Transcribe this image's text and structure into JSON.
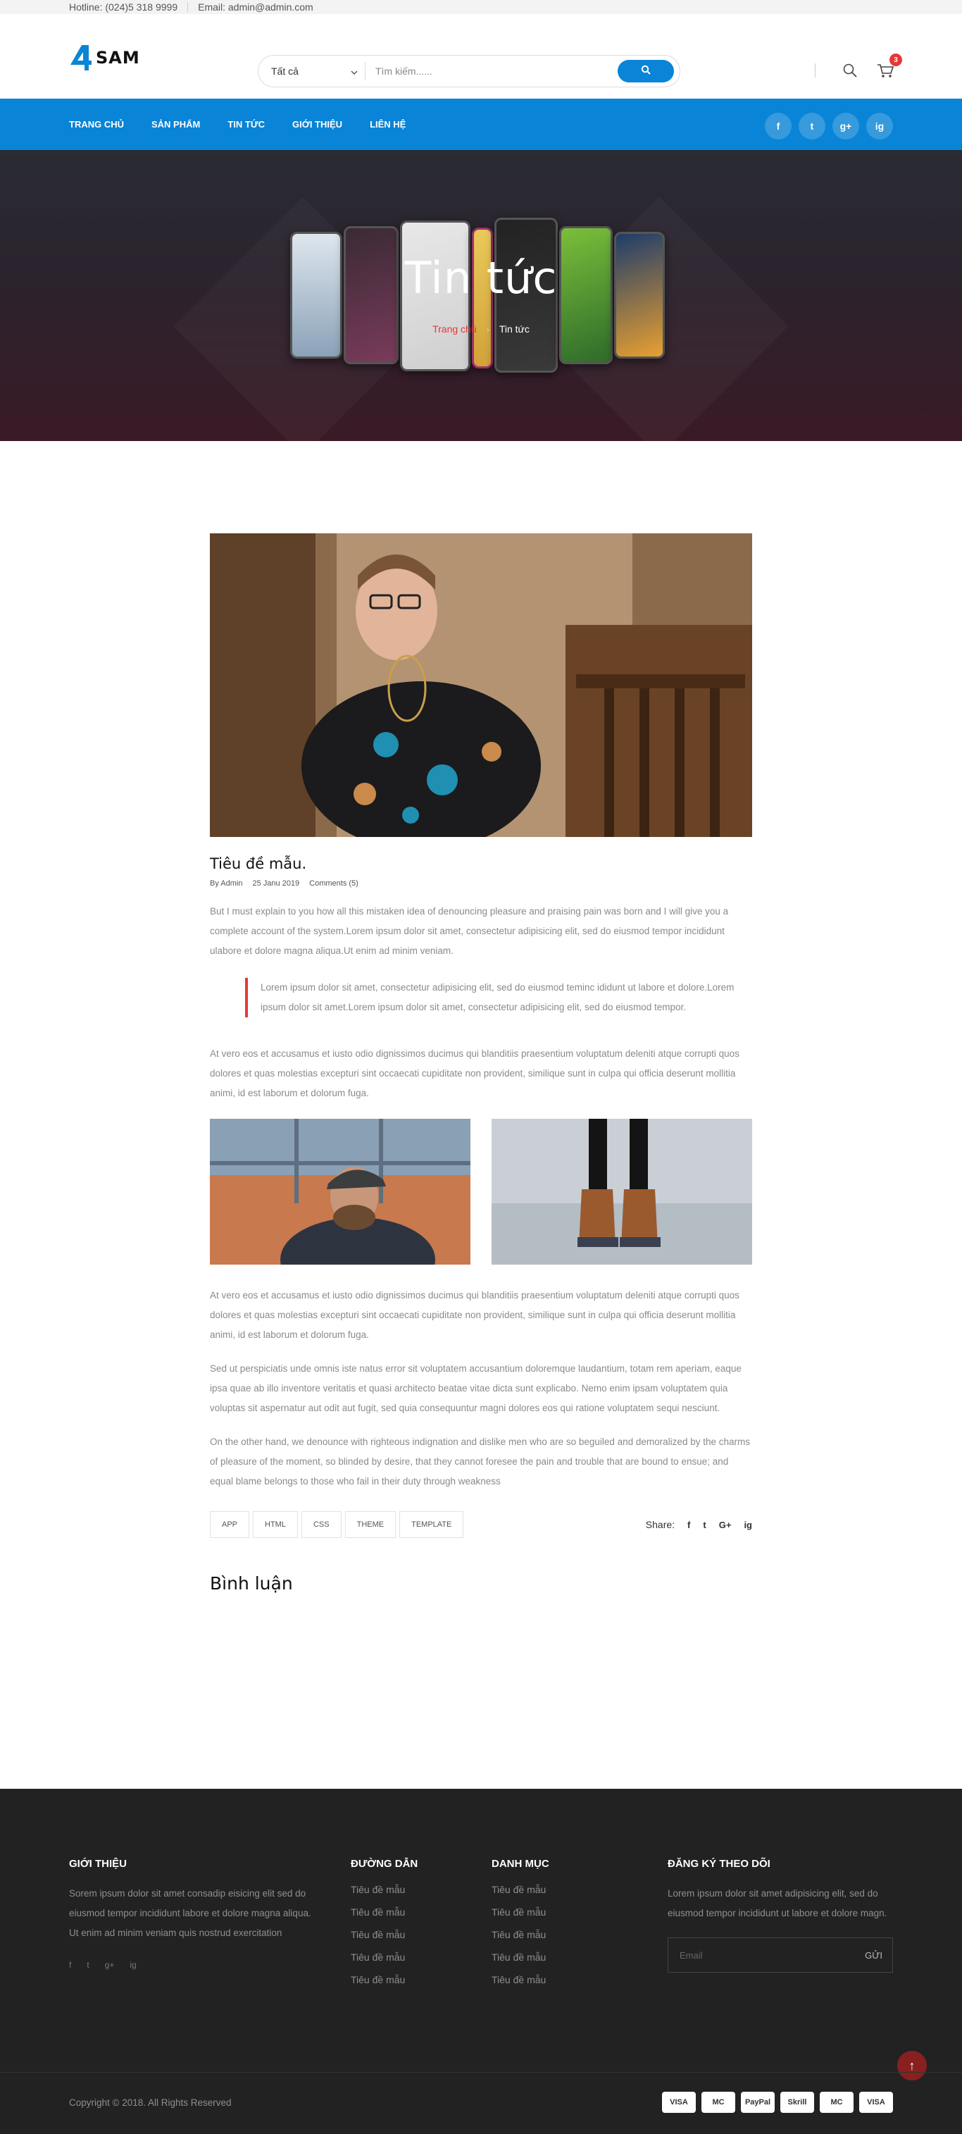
{
  "topbar": {
    "hotline": "Hotline: (024)5 318 9999",
    "email": "Email: admin@admin.com"
  },
  "header": {
    "logo_text": "SAM",
    "search": {
      "category": "Tất cả",
      "placeholder": "Tìm kiếm......"
    },
    "cart_count": "3"
  },
  "nav": {
    "items": [
      "TRANG CHỦ",
      "SẢN PHẨM",
      "TIN TỨC",
      "GIỚI THIỆU",
      "LIÊN HỆ"
    ],
    "social": [
      "f",
      "t",
      "g+",
      "ig"
    ]
  },
  "hero": {
    "title": "Tin tức",
    "breadcrumb_home": "Trang chủ",
    "breadcrumb_current": "Tin tức"
  },
  "post": {
    "title": "Tiêu đề mẫu.",
    "author": "By Admin",
    "date": "25 Janu 2019",
    "comments": "Comments (5)",
    "para1": "But I must explain to you how all this mistaken idea of denouncing pleasure and praising pain was born and I will give you a complete account of the system.Lorem ipsum dolor sit amet, consectetur adipisicing elit, sed do eiusmod tempor incididunt ulabore et dolore magna aliqua.Ut enim ad minim veniam.",
    "quote": "Lorem ipsum dolor sit amet, consectetur adipisicing elit, sed do eiusmod teminc ididunt ut labore et dolore.Lorem ipsum dolor sit amet.Lorem ipsum dolor sit amet, consectetur adipisicing elit, sed do eiusmod tempor.",
    "para2": "At vero eos et accusamus et iusto odio dignissimos ducimus qui blanditiis praesentium voluptatum deleniti atque corrupti quos dolores et quas molestias excepturi sint occaecati cupiditate non provident, similique sunt in culpa qui officia deserunt mollitia animi, id est laborum et dolorum fuga.",
    "para3": "At vero eos et accusamus et iusto odio dignissimos ducimus qui blanditiis praesentium voluptatum deleniti atque corrupti quos dolores et quas molestias excepturi sint occaecati cupiditate non provident, similique sunt in culpa qui officia deserunt mollitia animi, id est laborum et dolorum fuga.",
    "para4": "Sed ut perspiciatis unde omnis iste natus error sit voluptatem accusantium doloremque laudantium, totam rem aperiam, eaque ipsa quae ab illo inventore veritatis et quasi architecto beatae vitae dicta sunt explicabo. Nemo enim ipsam voluptatem quia voluptas sit aspernatur aut odit aut fugit, sed quia consequuntur magni dolores eos qui ratione voluptatem sequi nesciunt.",
    "para5": "On the other hand, we denounce with righteous indignation and dislike men who are so beguiled and demoralized by the charms of pleasure of the moment, so blinded by desire, that they cannot foresee the pain and trouble that are bound to ensue; and equal blame belongs to those who fail in their duty through weakness",
    "tags": [
      "APP",
      "HTML",
      "CSS",
      "THEME",
      "TEMPLATE"
    ],
    "share_label": "Share:",
    "share_icons": [
      "f",
      "t",
      "G+",
      "ig"
    ]
  },
  "comments_title": "Bình luận",
  "footer": {
    "about": {
      "title": "GIỚI THIỆU",
      "text": "Sorem ipsum dolor sit amet consadip eisicing elit sed do eiusmod tempor incididunt labore et dolore magna aliqua. Ut enim ad minim veniam quis nostrud exercitation",
      "social": [
        "f",
        "t",
        "g+",
        "ig"
      ]
    },
    "links": {
      "title": "ĐƯỜNG DẪN",
      "items": [
        "Tiêu đề mẫu",
        "Tiêu đề mẫu",
        "Tiêu đề mẫu",
        "Tiêu đề mẫu",
        "Tiêu đề mẫu"
      ]
    },
    "categories": {
      "title": "DANH MỤC",
      "items": [
        "Tiêu đề mẫu",
        "Tiêu đề mẫu",
        "Tiêu đề mẫu",
        "Tiêu đề mẫu",
        "Tiêu đề mẫu"
      ]
    },
    "subscribe": {
      "title": "ĐĂNG KÝ THEO DÕI",
      "text": "Lorem ipsum dolor sit amet adipisicing elit, sed do eiusmod tempor incididunt ut labore et dolore magn.",
      "placeholder": "Email",
      "button": "GỬI"
    },
    "copyright": "Copyright © 2018. All Rights Reserved",
    "payments": [
      "VISA",
      "MC",
      "PayPal",
      "Skrill",
      "MC",
      "VISA"
    ]
  },
  "colors": {
    "primary": "#0a84d6",
    "accent": "#e53935",
    "footer_bg": "#222223"
  }
}
